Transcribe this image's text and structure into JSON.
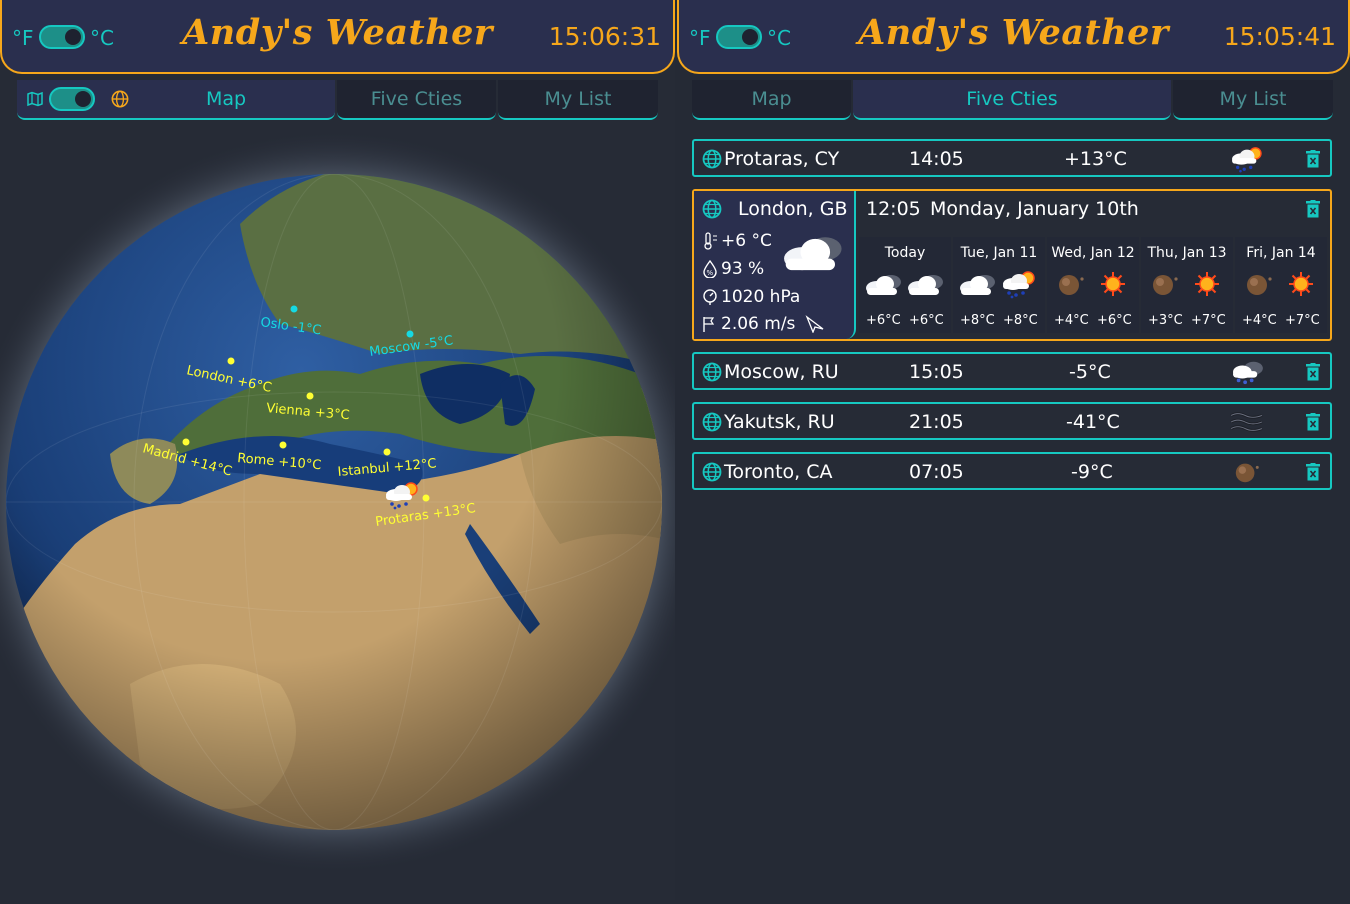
{
  "left_panel": {
    "header": {
      "unit_f": "°F",
      "unit_c": "°C",
      "title": "Andy's Weather",
      "clock": "15:06:31"
    },
    "tabs": [
      "Map",
      "Five Cties",
      "My List"
    ],
    "active_tab": "Map",
    "map_mode_icons": [
      "map-icon",
      "globe-icon"
    ],
    "globe_labels": [
      {
        "city": "Oslo",
        "temp": "-1°C",
        "text": "Oslo -1°C",
        "color": "#16d9e3"
      },
      {
        "city": "Moscow",
        "temp": "-5°C",
        "text": "Moscow -5°C",
        "color": "#16d9e3"
      },
      {
        "city": "London",
        "temp": "+6°C",
        "text": "London +6°C",
        "color": "#ffff33"
      },
      {
        "city": "Vienna",
        "temp": "+3°C",
        "text": "Vienna +3°C",
        "color": "#ffff33"
      },
      {
        "city": "Madrid",
        "temp": "+14°C",
        "text": "Madrid +14°C",
        "color": "#ffff33"
      },
      {
        "city": "Rome",
        "temp": "+10°C",
        "text": "Rome +10°C",
        "color": "#ffff33"
      },
      {
        "city": "Istanbul",
        "temp": "+12°C",
        "text": "Istanbul +12°C",
        "color": "#ffff33"
      },
      {
        "city": "Protaras",
        "temp": "+13°C",
        "text": "Protaras +13°C",
        "color": "#ffff33"
      }
    ]
  },
  "right_panel": {
    "header": {
      "unit_f": "°F",
      "unit_c": "°C",
      "title": "Andy's Weather",
      "clock": "15:05:41"
    },
    "tabs": [
      "Map",
      "Five Cties",
      "My List"
    ],
    "active_tab": "Five Cties",
    "cities": [
      {
        "name": "Protaras, CY",
        "time": "14:05",
        "temp": "+13°C",
        "icon": "rain-sun-icon"
      },
      {
        "name": "Moscow, RU",
        "time": "15:05",
        "temp": "-5°C",
        "icon": "snow-cloud-icon"
      },
      {
        "name": "Yakutsk, RU",
        "time": "21:05",
        "temp": "-41°C",
        "icon": "fog-icon"
      },
      {
        "name": "Toronto, CA",
        "time": "07:05",
        "temp": "-9°C",
        "icon": "clear-night-icon"
      }
    ],
    "london": {
      "name": "London, GB",
      "time": "12:05",
      "date": "Monday, January 10th",
      "temperature": "+6 °C",
      "humidity": "93 %",
      "pressure": "1020 hPa",
      "wind": "2.06 m/s",
      "icon": "cloudy-icon",
      "forecast": [
        {
          "day": "Today",
          "t1": "+6°C",
          "t2": "+6°C",
          "icons": [
            "cloudy-icon",
            "cloudy-icon"
          ]
        },
        {
          "day": "Tue, Jan 11",
          "t1": "+8°C",
          "t2": "+8°C",
          "icons": [
            "cloudy-icon",
            "rain-sun-icon"
          ]
        },
        {
          "day": "Wed, Jan 12",
          "t1": "+4°C",
          "t2": "+6°C",
          "icons": [
            "clear-night-icon",
            "sun-icon"
          ]
        },
        {
          "day": "Thu, Jan 13",
          "t1": "+3°C",
          "t2": "+7°C",
          "icons": [
            "clear-night-icon",
            "sun-icon"
          ]
        },
        {
          "day": "Fri, Jan 14",
          "t1": "+4°C",
          "t2": "+7°C",
          "icons": [
            "clear-night-icon",
            "sun-icon"
          ]
        }
      ]
    }
  },
  "colors": {
    "accent_orange": "#f6a71b",
    "accent_teal": "#16c8c1",
    "header_bg": "#2a2f4e",
    "page_bg": "#252a35"
  }
}
